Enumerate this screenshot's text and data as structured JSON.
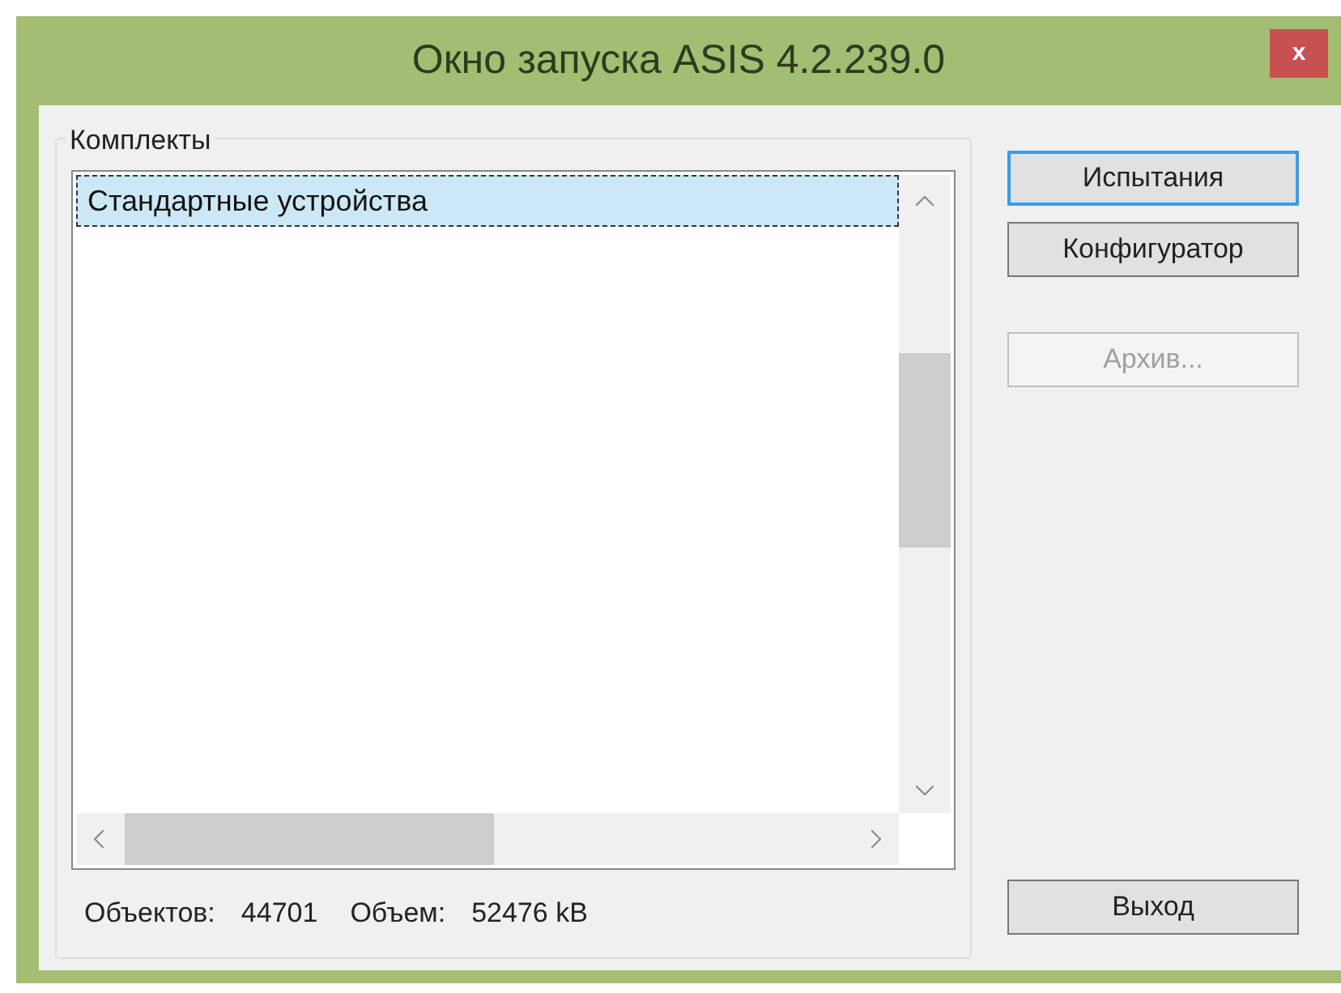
{
  "window": {
    "title": "Окно запуска ASIS 4.2.239.0",
    "close": "x"
  },
  "group": {
    "title": "Комплекты",
    "items": [
      {
        "label": "Стандартные устройства",
        "selected": true
      }
    ],
    "stats": [
      {
        "label": "Объектов:",
        "value": "44701"
      },
      {
        "label": "Объем:",
        "value": "52476 kB"
      }
    ]
  },
  "buttons": [
    {
      "label": "Испытания",
      "focused": true,
      "disabled": false
    },
    {
      "label": "Конфигуратор",
      "focused": false,
      "disabled": false
    },
    {
      "label": "Архив...",
      "focused": false,
      "disabled": true
    }
  ],
  "exit_button": {
    "label": "Выход"
  }
}
